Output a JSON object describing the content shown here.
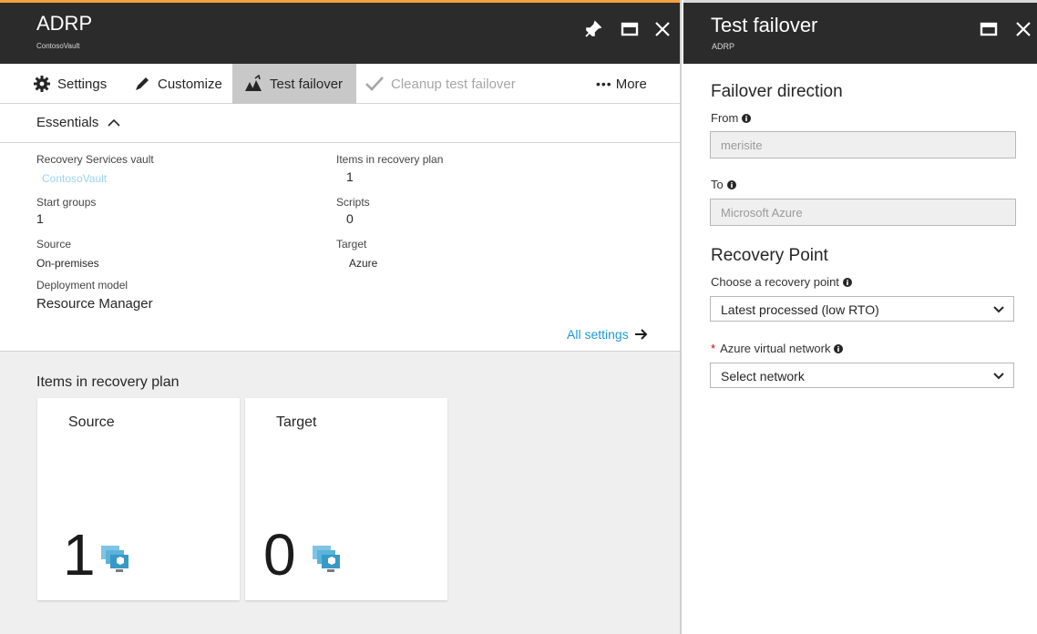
{
  "left_blade": {
    "title": "ADRP",
    "subtitle": "ContosoVault",
    "commands": {
      "settings": "Settings",
      "customize": "Customize",
      "test_failover": "Test failover",
      "cleanup": "Cleanup test failover",
      "more": "More"
    },
    "essentials_label": "Essentials",
    "essentials": {
      "vault_label": "Recovery Services vault",
      "vault_value": "ContosoVault",
      "items_label": "Items in recovery plan",
      "items_value": "1",
      "start_groups_label": "Start groups",
      "start_groups_value": "1",
      "scripts_label": "Scripts",
      "scripts_value": "0",
      "source_label": "Source",
      "source_value": "On-premises",
      "target_label": "Target",
      "target_value": "Azure",
      "deployment_label": "Deployment model",
      "deployment_value": "Resource Manager"
    },
    "all_settings": "All settings",
    "items_section": {
      "title": "Items in recovery plan",
      "tiles": [
        {
          "label": "Source",
          "count": "1"
        },
        {
          "label": "Target",
          "count": "0"
        }
      ]
    }
  },
  "right_blade": {
    "title": "Test failover",
    "subtitle": "ADRP",
    "failover_direction": "Failover direction",
    "from_label": "From",
    "from_value": "merisite",
    "to_label": "To",
    "to_value": "Microsoft Azure",
    "recovery_point": "Recovery Point",
    "choose_label": "Choose a recovery point",
    "choose_value": "Latest processed (low RTO)",
    "network_label": "Azure virtual network",
    "network_value": "Select network"
  },
  "colors": {
    "header_bg": "#2b2b2b",
    "accent_top": "#f2a23c",
    "link": "#1f9ad6",
    "required": "#cc0000"
  }
}
